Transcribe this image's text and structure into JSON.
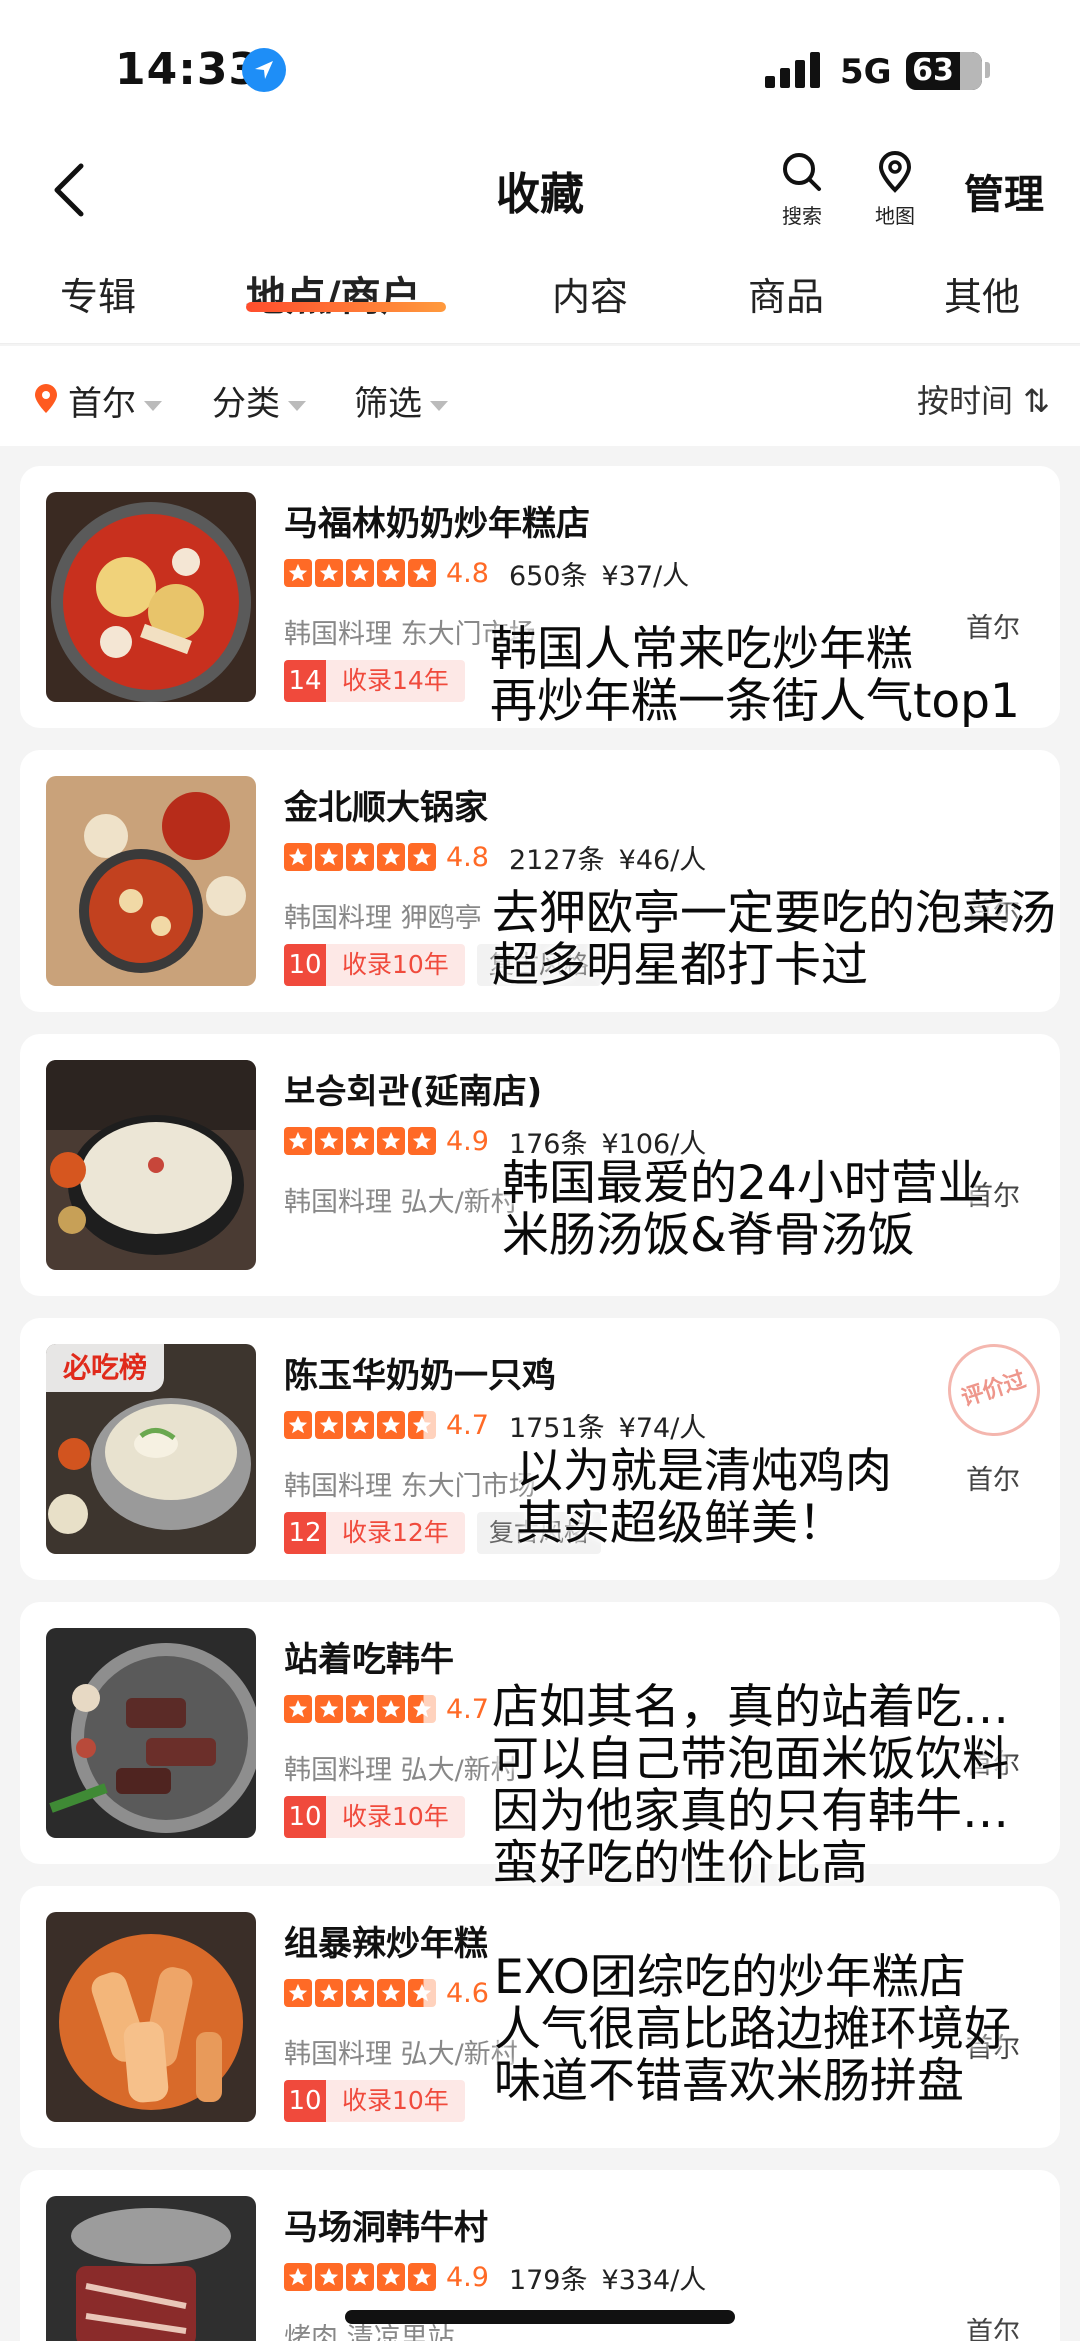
{
  "status_bar": {
    "time": "14:33",
    "network": "5G",
    "battery": "63",
    "battery_level": 0.63
  },
  "nav": {
    "back_icon": "chevron-left-icon",
    "title": "收藏",
    "search_label": "搜索",
    "map_label": "地图",
    "manage_label": "管理"
  },
  "tabs": [
    {
      "label": "专辑",
      "active": false
    },
    {
      "label": "地点/商户",
      "active": true
    },
    {
      "label": "内容",
      "active": false
    },
    {
      "label": "商品",
      "active": false
    },
    {
      "label": "其他",
      "active": false
    }
  ],
  "filters": {
    "city": "首尔",
    "category": "分类",
    "filter": "筛选",
    "sort": "按时间 ⇅"
  },
  "colors": {
    "accent": "#ff6a26",
    "tag_red": "#f04a3c"
  },
  "items": [
    {
      "name": "马福林奶奶炒年糕店",
      "score": "4.8",
      "reviews": "650条",
      "price": "¥37/人",
      "category": "韩国料理 东大门市场",
      "city": "首尔",
      "tag_num": "14",
      "tag_text": "收录14年",
      "extra_tag": "",
      "stars": 5,
      "note": [
        "韩国人常来吃炒年糕",
        "再炒年糕一条街人气top1"
      ]
    },
    {
      "name": "金北顺大锅家",
      "score": "4.8",
      "reviews": "2127条",
      "price": "¥46/人",
      "category": "韩国料理 狎鸥亭",
      "city": "首尔",
      "tag_num": "10",
      "tag_text": "收录10年",
      "extra_tag": "复古风格",
      "stars": 5,
      "note": [
        "去狎欧亭一定要吃的泡菜汤",
        "超多明星都打卡过"
      ]
    },
    {
      "name": "보승회관(延南店)",
      "score": "4.9",
      "reviews": "176条",
      "price": "¥106/人",
      "category": "韩国料理 弘大/新村",
      "city": "首尔",
      "tag_num": "",
      "tag_text": "",
      "extra_tag": "",
      "stars": 5,
      "note": [
        "韩国最爱的24小时营业",
        "米肠汤饭&脊骨汤饭"
      ]
    },
    {
      "name": "陈玉华奶奶一只鸡",
      "score": "4.7",
      "reviews": "1751条",
      "price": "¥74/人",
      "category": "韩国料理 东大门市场",
      "city": "首尔",
      "tag_num": "12",
      "tag_text": "收录12年",
      "extra_tag": "复古风格",
      "stars": 4.5,
      "badge": "必吃榜",
      "stamp": "评价过",
      "note": [
        "以为就是清炖鸡肉",
        "其实超级鲜美！"
      ]
    },
    {
      "name": "站着吃韩牛",
      "score": "4.7",
      "reviews": "",
      "price": "",
      "category": "韩国料理 弘大/新村",
      "city": "首尔",
      "tag_num": "10",
      "tag_text": "收录10年",
      "extra_tag": "",
      "stars": 4.5,
      "note": [
        "店如其名，真的站着吃…",
        "可以自己带泡面米饭饮料",
        "因为他家真的只有韩牛…",
        "蛮好吃的性价比高"
      ]
    },
    {
      "name": "组暴辣炒年糕",
      "score": "4.6",
      "reviews": "",
      "price": "",
      "category": "韩国料理 弘大/新村",
      "city": "首尔",
      "tag_num": "10",
      "tag_text": "收录10年",
      "extra_tag": "",
      "stars": 4.5,
      "note": [
        "EXO团综吃的炒年糕店",
        "人气很高比路边摊环境好",
        "味道不错喜欢米肠拼盘"
      ]
    },
    {
      "name": "马场洞韩牛村",
      "score": "4.9",
      "reviews": "179条",
      "price": "¥334/人",
      "category": "烤肉 清凉里站",
      "city": "首尔",
      "tag_num": "",
      "tag_text": "",
      "extra_tag": "",
      "stars": 5,
      "note": []
    }
  ]
}
